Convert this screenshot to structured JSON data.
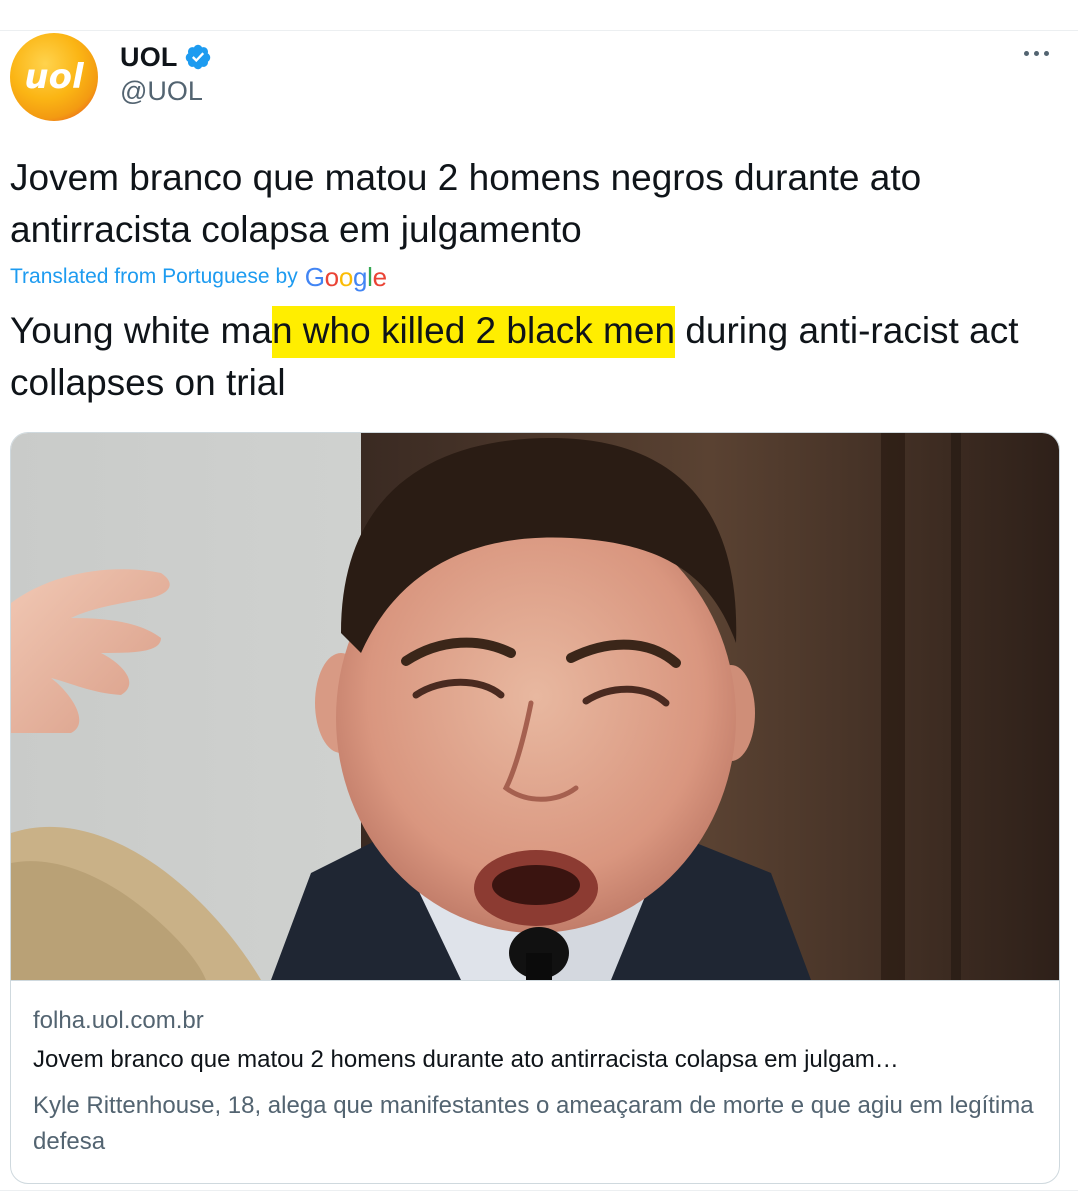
{
  "account": {
    "display_name": "UOL",
    "handle": "@UOL",
    "verified": true,
    "avatar_logo_text": "uol"
  },
  "tweet": {
    "original_text": "Jovem branco que matou 2 homens negros durante ato antirracista colapsa em julgamento",
    "translation_label": "Translated from Portuguese",
    "translation_by": "by",
    "translation_provider": "Google",
    "translated_text_before": "Young white ma",
    "translated_text_highlight": "n who killed 2 black men",
    "translated_text_after": " during anti-racist act collapses on trial",
    "highlight_color": "#ffee00"
  },
  "card": {
    "image_icon": "news-photo-crying-young-man",
    "domain": "folha.uol.com.br",
    "title": "Jovem branco que matou 2 homens durante ato antirracista colapsa em julgam…",
    "description": "Kyle Rittenhouse, 18, alega que manifestantes o ameaçaram de morte e que agiu em legítima defesa"
  },
  "colors": {
    "text": "#0f1419",
    "secondary": "#536471",
    "link": "#1d9bf0",
    "border": "#cfd9de",
    "verified": "#1d9bf0"
  }
}
